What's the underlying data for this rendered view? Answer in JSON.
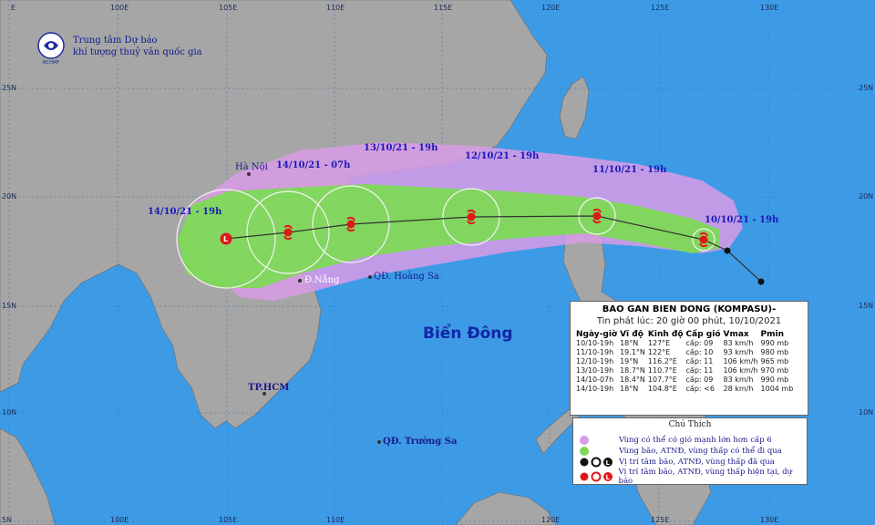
{
  "agency": {
    "line1": "Trung tâm Dự báo",
    "line2": "khí tượng thuỷ văn quốc gia",
    "logo_text": "NCHMF"
  },
  "grid": {
    "top_lon": [
      "E",
      "100E",
      "105E",
      "110E",
      "115E",
      "120E",
      "125E",
      "130E"
    ],
    "bottom_lon": [
      "100E",
      "105E",
      "110E",
      "115E",
      "120E",
      "125E",
      "130E"
    ],
    "left_lat": [
      "25N",
      "20N",
      "15N",
      "10N",
      "5N"
    ],
    "right_lat": [
      "25N",
      "20N",
      "15N",
      "10N"
    ]
  },
  "sea_name": "Biển Đông",
  "places": {
    "hanoi": "Hà Nội",
    "danang": "Đ.Nẵng",
    "hoangsa": "QĐ. Hoàng Sa",
    "hcm": "TP.HCM",
    "truongsa": "QĐ. Trường Sa"
  },
  "forecast_labels": [
    "10/10/21 - 19h",
    "11/10/21 - 19h",
    "12/10/21 - 19h",
    "13/10/21 - 19h",
    "14/10/21 - 07h",
    "14/10/21 - 19h"
  ],
  "info": {
    "title": "BAO GAN BIEN DONG (KOMPASU)-",
    "subtitle": "Tin phát lúc: 20 giờ 00 phút, 10/10/2021",
    "headers": [
      "Ngày-giờ",
      "Vĩ độ",
      "Kinh độ",
      "Cấp gió",
      "Vmax",
      "Pmin"
    ],
    "rows": [
      [
        "10/10-19h",
        "18°N",
        "127°E",
        "cấp: 09",
        "83 km/h",
        "990 mb"
      ],
      [
        "11/10-19h",
        "19.1°N",
        "122°E",
        "cấp: 10",
        "93 km/h",
        "980 mb"
      ],
      [
        "12/10-19h",
        "19°N",
        "116.2°E",
        "cấp: 11",
        "106 km/h",
        "965 mb"
      ],
      [
        "13/10-19h",
        "18.7°N",
        "110.7°E",
        "cấp: 11",
        "106 km/h",
        "970 mb"
      ],
      [
        "14/10-07h",
        "18.4°N",
        "107.7°E",
        "cấp: 09",
        "83 km/h",
        "990 mb"
      ],
      [
        "14/10-19h",
        "18°N",
        "104.8°E",
        "cấp: <6",
        "28 km/h",
        "1004 mb"
      ]
    ]
  },
  "legend": {
    "title": "Chú Thích",
    "items": [
      "Vùng có thể có gió mạnh lớn hơn cấp 6",
      "Vùng bão, ATNĐ, vùng thấp có thể đi qua",
      "Vị trí tâm bão, ATNĐ, vùng thấp đã qua",
      "Vị trí tâm bão, ATNĐ, vùng thấp hiện tại, dự báo"
    ],
    "colors": {
      "strong_wind": "#d99be6",
      "storm_zone": "#7ed957",
      "past": "#111111",
      "forecast": "#e01818"
    }
  },
  "colors": {
    "sea": "#3d9be6",
    "land": "#a6a6a6",
    "purple_zone": "#d99be6",
    "green_zone": "#7ed957",
    "track": "#333333",
    "storm": "#e01818"
  }
}
